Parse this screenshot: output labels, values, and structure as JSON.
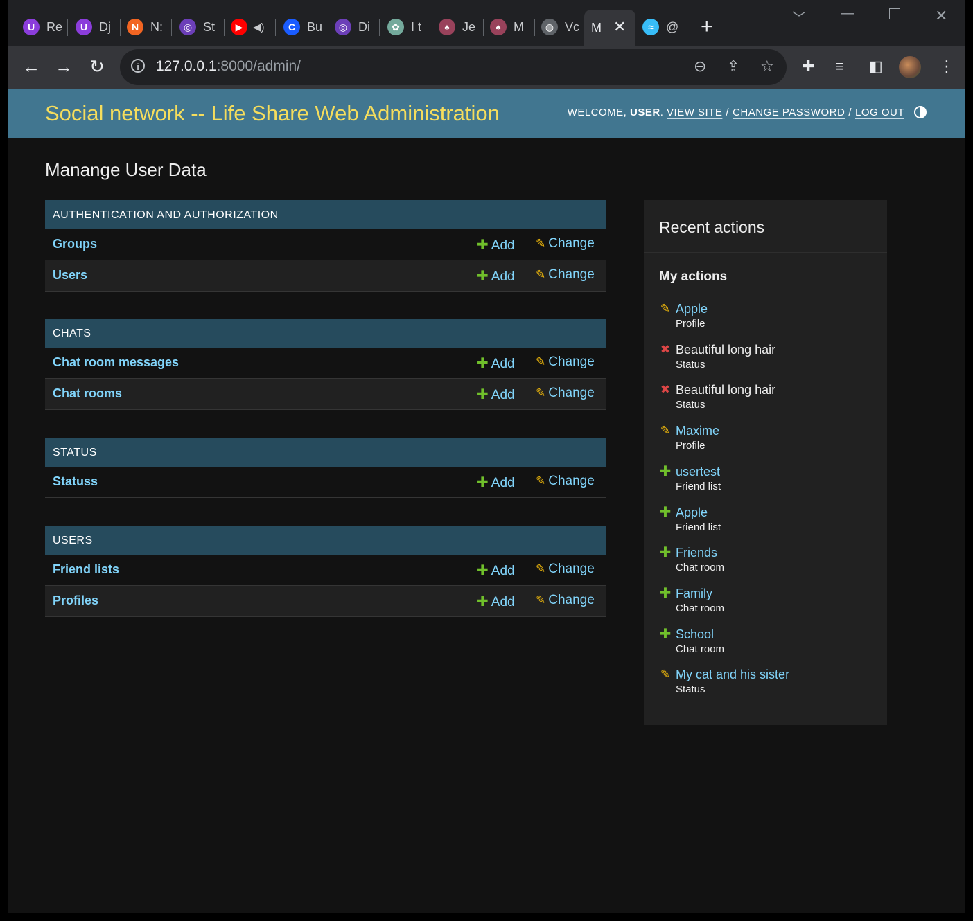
{
  "browser": {
    "tabs": [
      {
        "title": "Re",
        "icon": "u-icon",
        "color": "#8b3ddb",
        "glyph": "U"
      },
      {
        "title": "Dj",
        "icon": "u-icon",
        "color": "#8b3ddb",
        "glyph": "U"
      },
      {
        "title": "N:",
        "icon": "n-icon",
        "color": "#f26522",
        "glyph": "N"
      },
      {
        "title": "St",
        "icon": "ring-icon",
        "color": "#6c3fb8",
        "glyph": "◎"
      },
      {
        "title": "",
        "icon": "youtube-icon",
        "color": "#ff0000",
        "glyph": "▶"
      },
      {
        "title": "Bu",
        "icon": "c-icon",
        "color": "#1a5cff",
        "glyph": "C"
      },
      {
        "title": "Di",
        "icon": "ring-icon",
        "color": "#6c3fb8",
        "glyph": "◎"
      },
      {
        "title": "I t",
        "icon": "openai-icon",
        "color": "#74aa9c",
        "glyph": "✿"
      },
      {
        "title": "Je",
        "icon": "jest-icon",
        "color": "#99425b",
        "glyph": "♠"
      },
      {
        "title": "M",
        "icon": "jest-icon",
        "color": "#99425b",
        "glyph": "♠"
      },
      {
        "title": "Vc",
        "icon": "globe-icon",
        "color": "#5f6368",
        "glyph": "◍"
      },
      {
        "title": "@",
        "icon": "tailwind-icon",
        "color": "#38bdf8",
        "glyph": "≈"
      }
    ],
    "active_tab": {
      "title": "M",
      "close": "✕"
    },
    "url_host": "127.0.0.1",
    "url_rest": ":8000/admin/"
  },
  "header": {
    "branding": "Social network -- Life Share Web Administration",
    "welcome": "WELCOME,",
    "user": "USER",
    "view_site": "VIEW SITE",
    "change_password": "CHANGE PASSWORD",
    "log_out": "LOG OUT"
  },
  "page_title": "Manange User Data",
  "labels": {
    "add": "Add",
    "change": "Change"
  },
  "modules": [
    {
      "caption": "AUTHENTICATION AND AUTHORIZATION",
      "models": [
        "Groups",
        "Users"
      ]
    },
    {
      "caption": "CHATS",
      "models": [
        "Chat room messages",
        "Chat rooms"
      ]
    },
    {
      "caption": "STATUS",
      "models": [
        "Statuss"
      ]
    },
    {
      "caption": "USERS",
      "models": [
        "Friend lists",
        "Profiles"
      ]
    }
  ],
  "recent_actions": {
    "title": "Recent actions",
    "subtitle": "My actions",
    "items": [
      {
        "kind": "change",
        "object": "Apple",
        "type": "Profile",
        "link": true
      },
      {
        "kind": "delete",
        "object": "Beautiful long hair",
        "type": "Status",
        "link": false
      },
      {
        "kind": "delete",
        "object": "Beautiful long hair",
        "type": "Status",
        "link": false
      },
      {
        "kind": "change",
        "object": "Maxime",
        "type": "Profile",
        "link": true
      },
      {
        "kind": "add",
        "object": "usertest",
        "type": "Friend list",
        "link": true
      },
      {
        "kind": "add",
        "object": "Apple",
        "type": "Friend list",
        "link": true
      },
      {
        "kind": "add",
        "object": "Friends",
        "type": "Chat room",
        "link": true
      },
      {
        "kind": "add",
        "object": "Family",
        "type": "Chat room",
        "link": true
      },
      {
        "kind": "add",
        "object": "School",
        "type": "Chat room",
        "link": true
      },
      {
        "kind": "change",
        "object": "My cat and his sister",
        "type": "Status",
        "link": true
      }
    ]
  },
  "colors": {
    "header_bg": "#417690",
    "branding": "#f5dd5d",
    "caption_bg": "#264b5d",
    "link": "#81d4fa",
    "add_green": "#70bf2b",
    "change_yellow": "#efb80b",
    "delete_red": "#dd4646"
  }
}
